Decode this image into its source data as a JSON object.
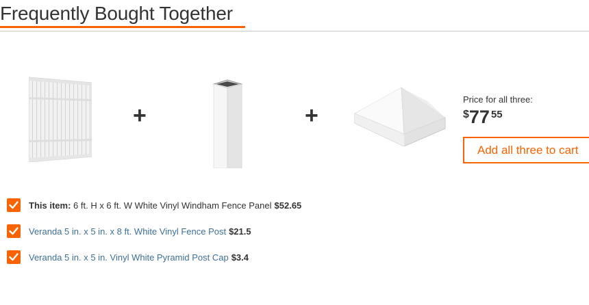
{
  "header": {
    "title": "Frequently Bought Together"
  },
  "products": [
    {
      "name": "fence-panel",
      "image_icon": "white-vinyl-fence-panel-image"
    },
    {
      "name": "fence-post",
      "image_icon": "white-vinyl-fence-post-image"
    },
    {
      "name": "post-cap",
      "image_icon": "white-pyramid-post-cap-image"
    }
  ],
  "plus_symbol": "+",
  "summary": {
    "price_label": "Price for all three:",
    "currency": "$",
    "price_dollars": "77",
    "price_cents": "55",
    "cart_button": "Add all three to cart"
  },
  "items": [
    {
      "checked": true,
      "prefix": "This item:",
      "name": "6 ft. H x 6 ft. W White Vinyl Windham Fence Panel",
      "price": "$52.65"
    },
    {
      "checked": true,
      "name": "Veranda 5 in. x 5 in. x 8 ft. White Vinyl Fence Post",
      "price": "$21.5"
    },
    {
      "checked": true,
      "name": "Veranda 5 in. x 5 in. Vinyl White Pyramid Post Cap",
      "price": "$3.4"
    }
  ],
  "colors": {
    "accent": "#f96302",
    "link": "#3d6f9c",
    "text": "#333333"
  }
}
